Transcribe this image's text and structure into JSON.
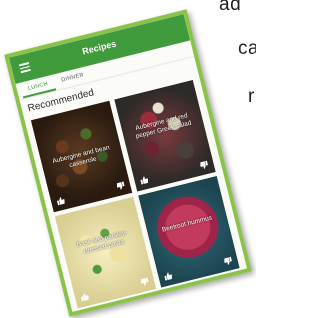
{
  "background_text": [
    "ad",
    "ca",
    "r"
  ],
  "app": {
    "title": "Recipes"
  },
  "tabs": [
    {
      "label": "LUNCH",
      "active": true
    },
    {
      "label": "DINNER",
      "active": false
    }
  ],
  "section_title": "Recommended",
  "recipes": [
    {
      "name": "Aubergine and bean casserole"
    },
    {
      "name": "Aubergine and red pepper Greek salad"
    },
    {
      "name": "Basil and parsley-dressed pasta"
    },
    {
      "name": "Beetroot hummus"
    }
  ],
  "colors": {
    "primary": "#3f9b3c",
    "frame": "#8bc34a"
  },
  "icons": {
    "menu": "hamburger-menu-icon",
    "like": "thumbs-up-icon",
    "dislike": "thumbs-down-icon"
  }
}
